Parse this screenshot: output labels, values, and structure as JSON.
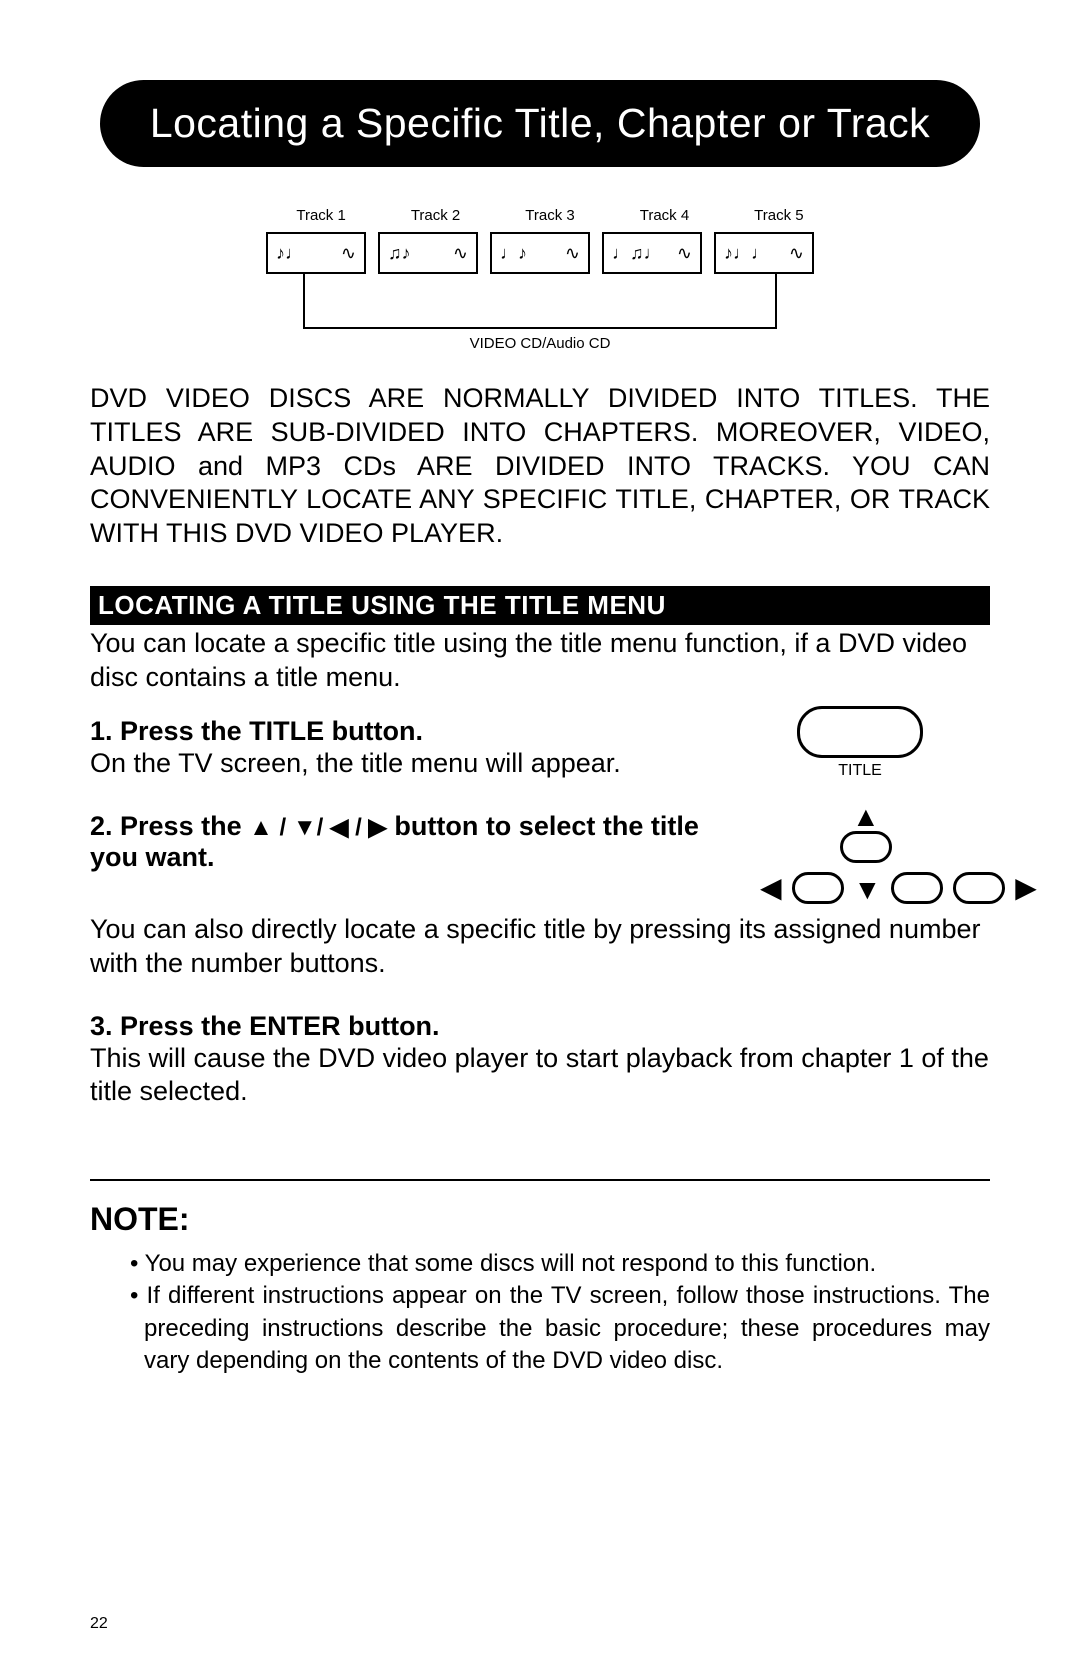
{
  "title": "Locating a Specific Title, Chapter or Track",
  "tracks": {
    "labels": [
      "Track 1",
      "Track 2",
      "Track 3",
      "Track 4",
      "Track 5"
    ],
    "notes": [
      "♪♩",
      "♫♪",
      "♩♪",
      "♩♫♩",
      "♪♩♩"
    ],
    "wave": "∿",
    "footer": "VIDEO CD/Audio CD"
  },
  "intro": "DVD VIDEO DISCS ARE NORMALLY DIVIDED INTO TITLES.  THE TITLES ARE SUB-DIVIDED INTO CHAPTERS.  MOREOVER, VIDEO, AUDIO and MP3 CDs ARE DIVIDED INTO TRACKS.  YOU CAN CONVENIENTLY LOCATE ANY SPECIFIC TITLE, CHAPTER, OR TRACK WITH THIS DVD VIDEO PLAYER.",
  "section_heading": "LOCATING A TITLE USING THE TITLE MENU",
  "section_intro": "You can locate a specific title using the title menu function, if a DVD video disc contains a title menu.",
  "step1_bold": "1. Press the TITLE button.",
  "step1_text": "On the TV screen, the title menu will appear.",
  "title_button_label": "TITLE",
  "step2_prefix": "2. Press the  ",
  "step2_arrows": "▲ / ▼/ ◀ / ▶",
  "step2_suffix": "  button to select the title you want.",
  "step2_aftertext": "You can also directly locate a specific title by pressing its assigned number with the number buttons.",
  "step3_bold": "3. Press the ENTER button.",
  "step3_text": "This will cause the DVD video player to start playback from chapter 1 of the title selected.",
  "note_heading": "NOTE:",
  "note1": "• You may experience that some discs will not respond to this function.",
  "note2": "• If different instructions appear on the TV screen, follow those instructions. The preceding instructions describe the basic procedure; these procedures may vary depending on the contents of the DVD video disc.",
  "page_number": "22"
}
